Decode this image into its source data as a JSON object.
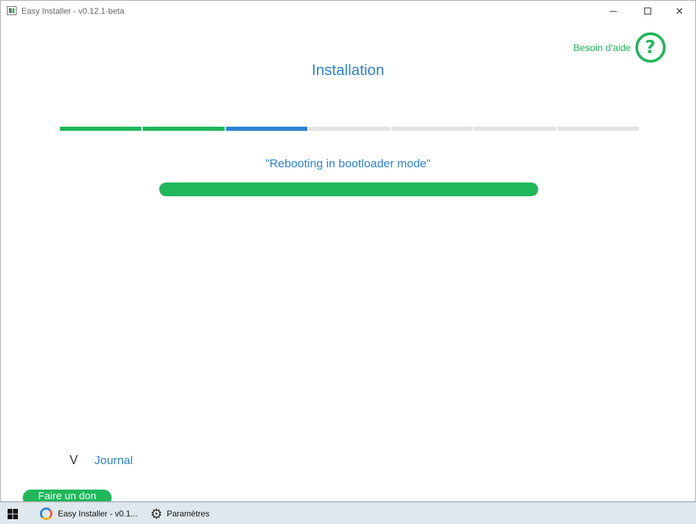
{
  "window": {
    "title": "Easy Installer - v0.12.1-beta",
    "controls": {
      "minimize": "minimize-icon",
      "maximize": "maximize-icon",
      "close": "close-icon"
    }
  },
  "help": {
    "label": "Besoin d'aide",
    "icon": "?"
  },
  "page": {
    "title": "Installation"
  },
  "steps": {
    "total": 7,
    "states": [
      "done",
      "done",
      "current",
      "pending",
      "pending",
      "pending",
      "pending"
    ]
  },
  "status": {
    "message": "\"Rebooting in bootloader mode\"",
    "progress": 1.0
  },
  "journal": {
    "toggle": "V",
    "label": "Journal"
  },
  "donate": {
    "label": "Faire un don"
  },
  "taskbar": {
    "items": [
      {
        "label": "Easy Installer - v0.1...",
        "icon": "easy-installer-icon"
      },
      {
        "label": "Paramètres",
        "icon": "gear-icon"
      }
    ]
  },
  "colors": {
    "green": "#1fb75a",
    "blue": "#2c83d4",
    "grey": "#e3e3e3"
  }
}
